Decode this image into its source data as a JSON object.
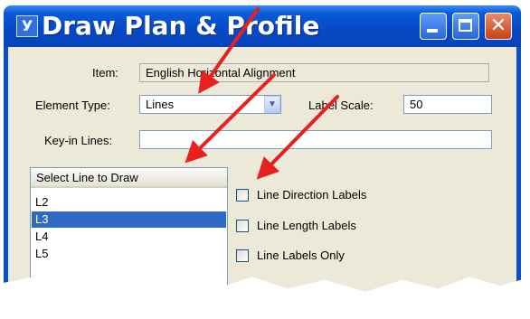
{
  "window": {
    "title": "Draw Plan & Profile",
    "app_icon_glyph": "У",
    "close_glyph": "✕"
  },
  "form": {
    "item_label": "Item:",
    "item_value": "English Horizontal Alignment",
    "element_type_label": "Element Type:",
    "element_type_value": "Lines",
    "label_scale_label": "Label Scale:",
    "label_scale_value": "50",
    "keyin_label": "Key-in Lines:",
    "keyin_value": ""
  },
  "list": {
    "header": "Select Line to Draw",
    "items": [
      "L2",
      "L3",
      "L4",
      "L5"
    ],
    "selected": "L3"
  },
  "options": [
    {
      "label": "Line Direction Labels",
      "checked": false
    },
    {
      "label": "Line Length Labels",
      "checked": false
    },
    {
      "label": "Line Labels Only",
      "checked": false
    }
  ],
  "colors": {
    "annotation_arrow": "#e82020",
    "title_bar": "#0a5ad8",
    "selection": "#316ac5"
  }
}
